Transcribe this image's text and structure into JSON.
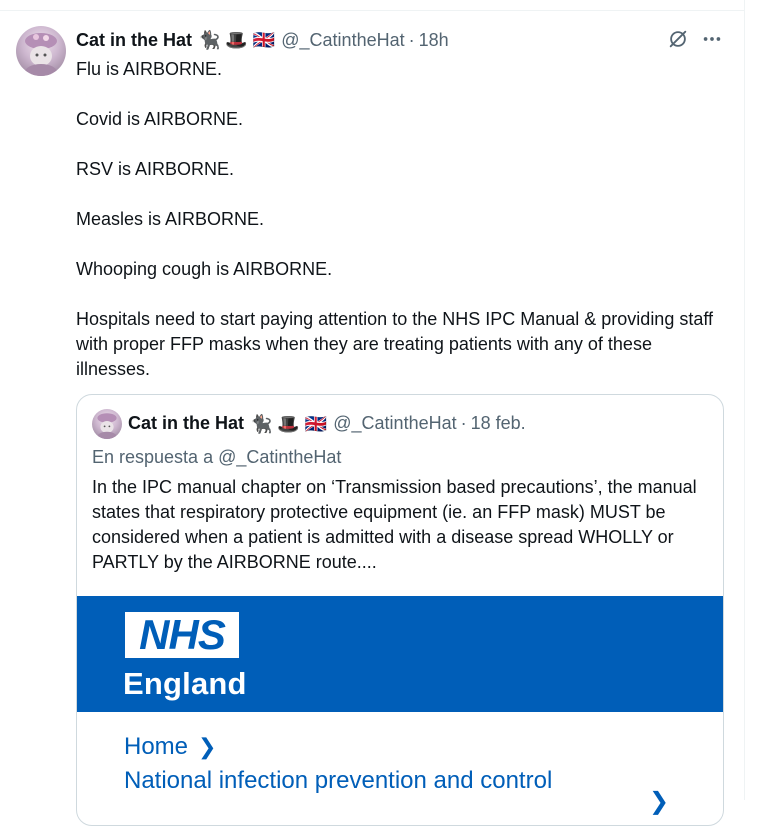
{
  "tweet": {
    "author_name": "Cat in the Hat",
    "author_emojis": "🐈‍⬛ 🎩 🇬🇧",
    "handle": "@_CatintheHat",
    "time": "18h",
    "paragraphs": [
      "Flu is AIRBORNE.",
      "Covid is AIRBORNE.",
      "RSV is AIRBORNE.",
      "Measles is AIRBORNE.",
      "Whooping cough is AIRBORNE.",
      "Hospitals need to start paying attention to the NHS IPC Manual & providing staff with proper FFP masks when they are treating patients with any of these illnesses."
    ],
    "icons": {
      "grok": "grok-icon",
      "more": "more-icon"
    }
  },
  "quote": {
    "author_name": "Cat in the Hat",
    "author_emojis": "🐈‍⬛ 🎩 🇬🇧",
    "handle": "@_CatintheHat",
    "date": "18 feb.",
    "reply_to": "En respuesta a @_CatintheHat",
    "text": "In the IPC manual chapter on ‘Transmission based precautions’, the manual states that respiratory protective equipment (ie. an FFP mask) MUST be considered when a patient is admitted with a disease spread WHOLLY or PARTLY by the AIRBORNE route....",
    "image": {
      "logo_text": "NHS",
      "org_name": "England",
      "breadcrumb": "Home",
      "page_title": "National infection prevention and control",
      "brand_color": "#005eb8"
    }
  }
}
